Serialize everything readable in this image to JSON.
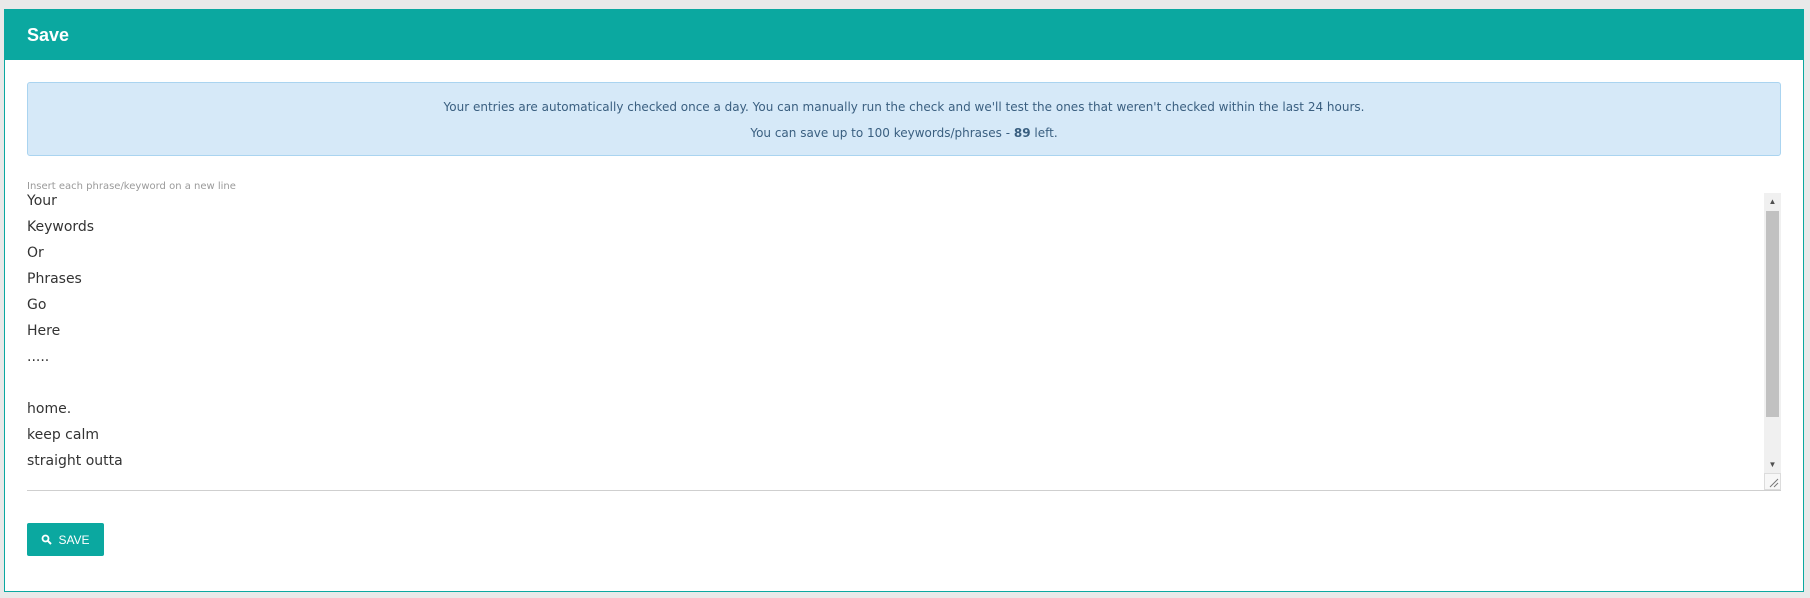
{
  "panel": {
    "title": "Save",
    "header_color": "#0ba8a0"
  },
  "alert": {
    "line1": "Your entries are automatically checked once a day. You can manually run the check and we'll test the ones that weren't checked within the last 24 hours.",
    "line2_prefix": "You can save up to 100 keywords/phrases - ",
    "line2_count": "89",
    "line2_suffix": " left."
  },
  "input": {
    "hint": "Insert each phrase/keyword on a new line",
    "lines": [
      "Your",
      "Keywords",
      "Or",
      "Phrases",
      "Go",
      "Here",
      ".....",
      "",
      "home.",
      "keep calm",
      "straight outta"
    ]
  },
  "actions": {
    "save_label": "SAVE",
    "save_icon": "search-icon"
  }
}
